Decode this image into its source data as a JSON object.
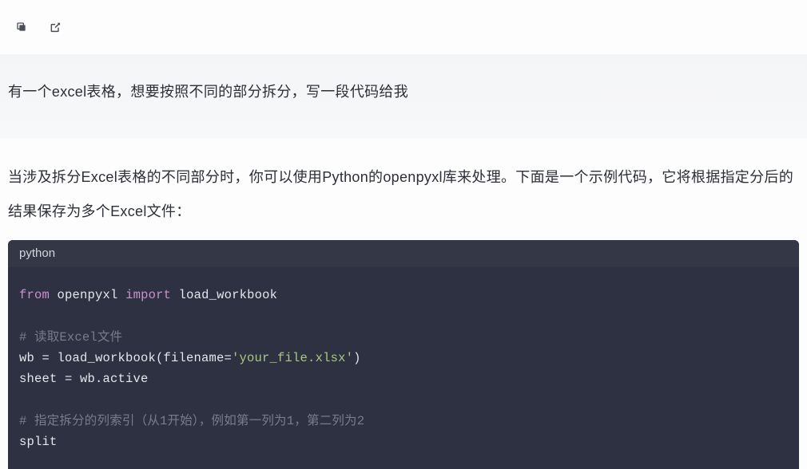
{
  "toolbar": {
    "copy_icon_label": "copy",
    "open_icon_label": "open-external"
  },
  "user": {
    "message": "有一个excel表格，想要按照不同的部分拆分，写一段代码给我"
  },
  "assistant": {
    "intro": "当涉及拆分Excel表格的不同部分时，你可以使用Python的openpyxl库来处理。下面是一个示例代码，它将根据指定分后的结果保存为多个Excel文件："
  },
  "code": {
    "language": "python",
    "tokens": {
      "kw_from": "from",
      "mod_openpyxl": "openpyxl",
      "kw_import": "import",
      "fn_load_workbook": "load_workbook",
      "comment_read": "# 读取Excel文件",
      "line_wb_prefix": "wb = load_workbook(filename=",
      "str_filename": "'your_file.xlsx'",
      "line_wb_suffix": ")",
      "line_sheet": "sheet = wb.active",
      "comment_split": "# 指定拆分的列索引（从1开始），例如第一列为1，第二列为2",
      "line_split": "split"
    }
  }
}
